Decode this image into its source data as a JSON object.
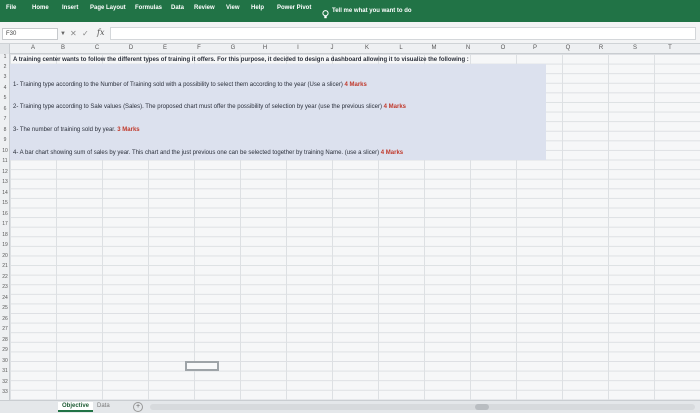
{
  "ribbon": {
    "tabs": [
      "File",
      "Home",
      "Insert",
      "Page Layout",
      "Formulas",
      "Data",
      "Review",
      "View",
      "Help",
      "Power Pivot"
    ],
    "tell_me": "Tell me what you want to do"
  },
  "formula_bar": {
    "name_box": "F30",
    "cancel_glyph": "✕",
    "enter_glyph": "✓",
    "fx_label": "fx",
    "formula": ""
  },
  "columns": [
    "A",
    "B",
    "C",
    "D",
    "E",
    "F",
    "G",
    "H",
    "I",
    "J",
    "K",
    "L",
    "M",
    "N",
    "O",
    "P",
    "Q",
    "R",
    "S",
    "T"
  ],
  "rows": [
    "1",
    "2",
    "3",
    "4",
    "5",
    "6",
    "7",
    "8",
    "9",
    "10",
    "11",
    "12",
    "13",
    "14",
    "15",
    "16",
    "17",
    "18",
    "19",
    "20",
    "21",
    "22",
    "23",
    "24",
    "25",
    "26",
    "27",
    "28",
    "29",
    "30",
    "31",
    "32",
    "33"
  ],
  "content": {
    "intro": "A training center wants to follow the different types of training it offers. For this purpose, it decided to design a dashboard allowing it to visualize the following :",
    "task1_text": "1- Training type according to the Number of Training sold with a possibility to select them according to the year (Use a slicer)",
    "task1_marks": "4 Marks",
    "task2_text": "2- Training type according to Sale values (Sales). The proposed chart must offer the possibility of selection by year (use the previous slicer)",
    "task2_marks": "4 Marks",
    "task3_text": "3- The number of training sold by year.",
    "task3_marks": "3 Marks",
    "task4_text": "4- A bar chart showing sum of sales by year. This chart and the just previous one can be selected together by training Name. (use a slicer)",
    "task4_marks": "4 Marks"
  },
  "sheets": {
    "active": "Objective",
    "other": "Data",
    "add_label": "+"
  },
  "colors": {
    "ribbon": "#217346",
    "highlight": "#dce1ee",
    "marks": "#c0392b"
  }
}
